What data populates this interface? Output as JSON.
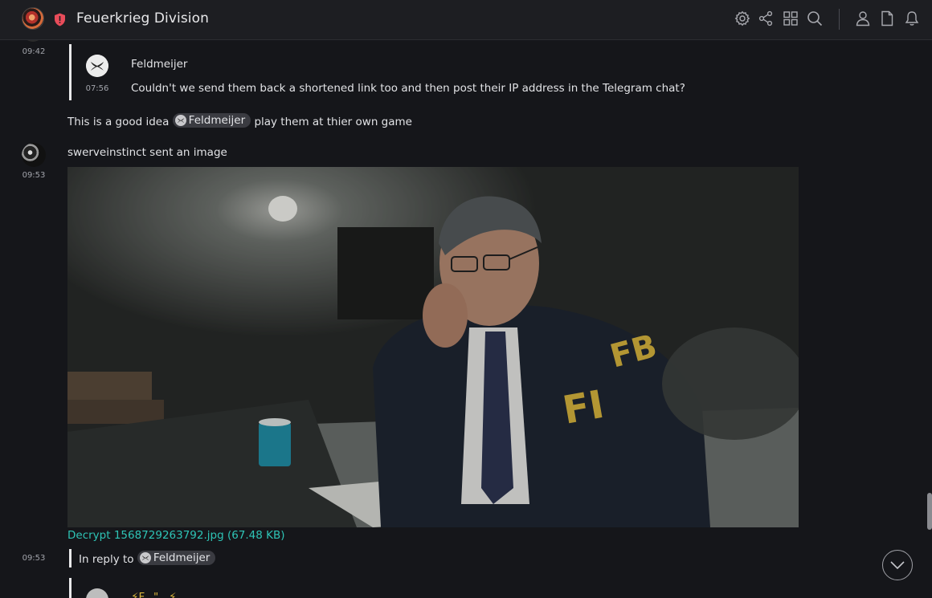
{
  "header": {
    "title": "Feuerkrieg Division",
    "icons": [
      "settings-icon",
      "share-icon",
      "apps-icon",
      "search-icon",
      "person-icon",
      "file-icon",
      "bell-icon"
    ]
  },
  "timeline": {
    "msg1": {
      "time": "09:42",
      "quote": {
        "time": "07:56",
        "sender": "Feldmeijer",
        "text": "Couldn't we send them back a shortened link too and then post their IP address in the Telegram chat?"
      },
      "text_before": "This is a good idea",
      "mention": "Feldmeijer",
      "text_after": "play them at thier own game"
    },
    "msg2": {
      "time": "09:53",
      "event_text": "swerveinstinct sent an image",
      "file_link": "Decrypt 1568729263792.jpg (67.48 KB)"
    },
    "msg3": {
      "time": "09:53",
      "reply_label": "In reply to",
      "reply_mention": "Feldmeijer",
      "partial_sender": "⚡F...\"...⚡"
    }
  },
  "colors": {
    "background": "#15161a",
    "header": "#1d1e22",
    "accent": "#2ec4b6",
    "shield": "#e84c5a"
  }
}
